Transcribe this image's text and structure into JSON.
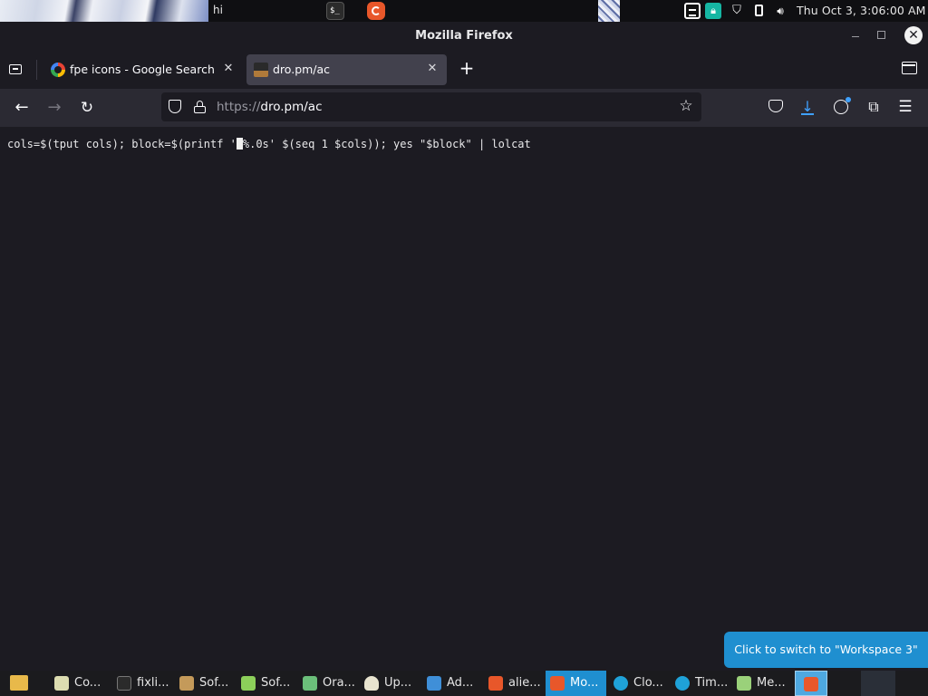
{
  "top_panel": {
    "window_label": "hi",
    "terminal_glyph": "$_",
    "clock": "Thu Oct  3,  3:06:00 AM"
  },
  "titlebar": {
    "title": "Mozilla Firefox",
    "close_glyph": "✕"
  },
  "tabs": [
    {
      "label": "fpe icons - Google Search",
      "icon": "google-icon",
      "close_glyph": "✕",
      "active": false
    },
    {
      "label": "dro.pm/ac",
      "icon": "dropm-icon",
      "close_glyph": "✕",
      "active": true
    }
  ],
  "new_tab_glyph": "+",
  "navbar": {
    "back_glyph": "←",
    "forward_glyph": "→",
    "reload_glyph": "↻",
    "url_scheme": "https://",
    "url_rest": "dro.pm/ac",
    "bookmark_glyph": "☆",
    "download_glyph": "↓",
    "extensions_glyph": "⧉",
    "menu_glyph": "☰"
  },
  "page": {
    "code_before": "cols=$(tput cols); block=$(printf '",
    "code_after": "%.0s' $(seq 1 $cols)); yes \"$block\" | lolcat"
  },
  "tooltip": "Click to switch to \"Workspace 3\"",
  "taskbar": {
    "items": [
      {
        "label": "Co...",
        "icon": "text-editor-icon"
      },
      {
        "label": "fixli...",
        "icon": "terminal-icon"
      },
      {
        "label": "Sof...",
        "icon": "software-icon"
      },
      {
        "label": "Sof...",
        "icon": "software-sources-icon"
      },
      {
        "label": "Ora...",
        "icon": "virtualbox-icon"
      },
      {
        "label": "Up...",
        "icon": "update-manager-icon"
      },
      {
        "label": "Ad...",
        "icon": "admin-icon"
      },
      {
        "label": "alie...",
        "icon": "firefox-icon"
      },
      {
        "label": "Mo...",
        "icon": "firefox-icon",
        "active": true
      },
      {
        "label": "Clo...",
        "icon": "clock-icon"
      },
      {
        "label": "Tim...",
        "icon": "timer-icon"
      },
      {
        "label": "Me...",
        "icon": "memory-icon"
      }
    ]
  },
  "colors": {
    "accent": "#1f8fd0",
    "page_background": "#1c1b22",
    "toolbar_background": "#2b2a33",
    "download_blue": "#3fa1ff"
  }
}
